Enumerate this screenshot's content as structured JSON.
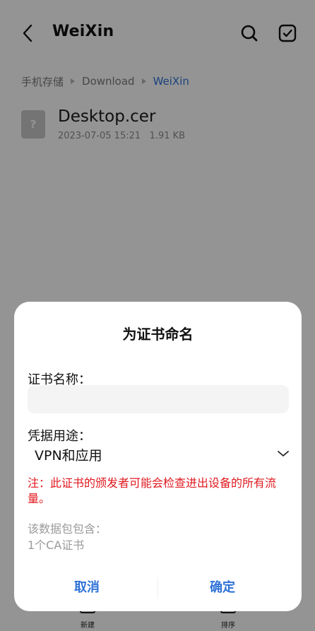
{
  "header": {
    "title": "WeiXin"
  },
  "breadcrumb": {
    "items": [
      "手机存储",
      "Download",
      "WeiXin"
    ]
  },
  "file": {
    "name": "Desktop.cer",
    "date": "2023-07-05 15:21",
    "size": "1.91 KB",
    "icon_glyph": "?"
  },
  "bottom_bar": {
    "new_label": "新建",
    "sort_label": "排序"
  },
  "dialog": {
    "title": "为证书命名",
    "name_label": "证书名称：",
    "name_value": "",
    "usage_label": "凭据用途：",
    "usage_value": "VPN和应用",
    "warning": "注：此证书的颁发者可能会检查进出设备的所有流量。",
    "contains_label": "该数据包包含：",
    "contains_value": "1个CA证书",
    "cancel_label": "取消",
    "ok_label": "确定"
  },
  "colors": {
    "accent": "#2f72d8",
    "warning": "#e0191f",
    "scrim": "rgba(0,0,0,0.42)"
  },
  "icons": [
    "back-arrow-icon",
    "search-icon",
    "select-all-icon",
    "file-unknown-icon",
    "chevron-down-icon",
    "new-icon",
    "sort-icon"
  ]
}
